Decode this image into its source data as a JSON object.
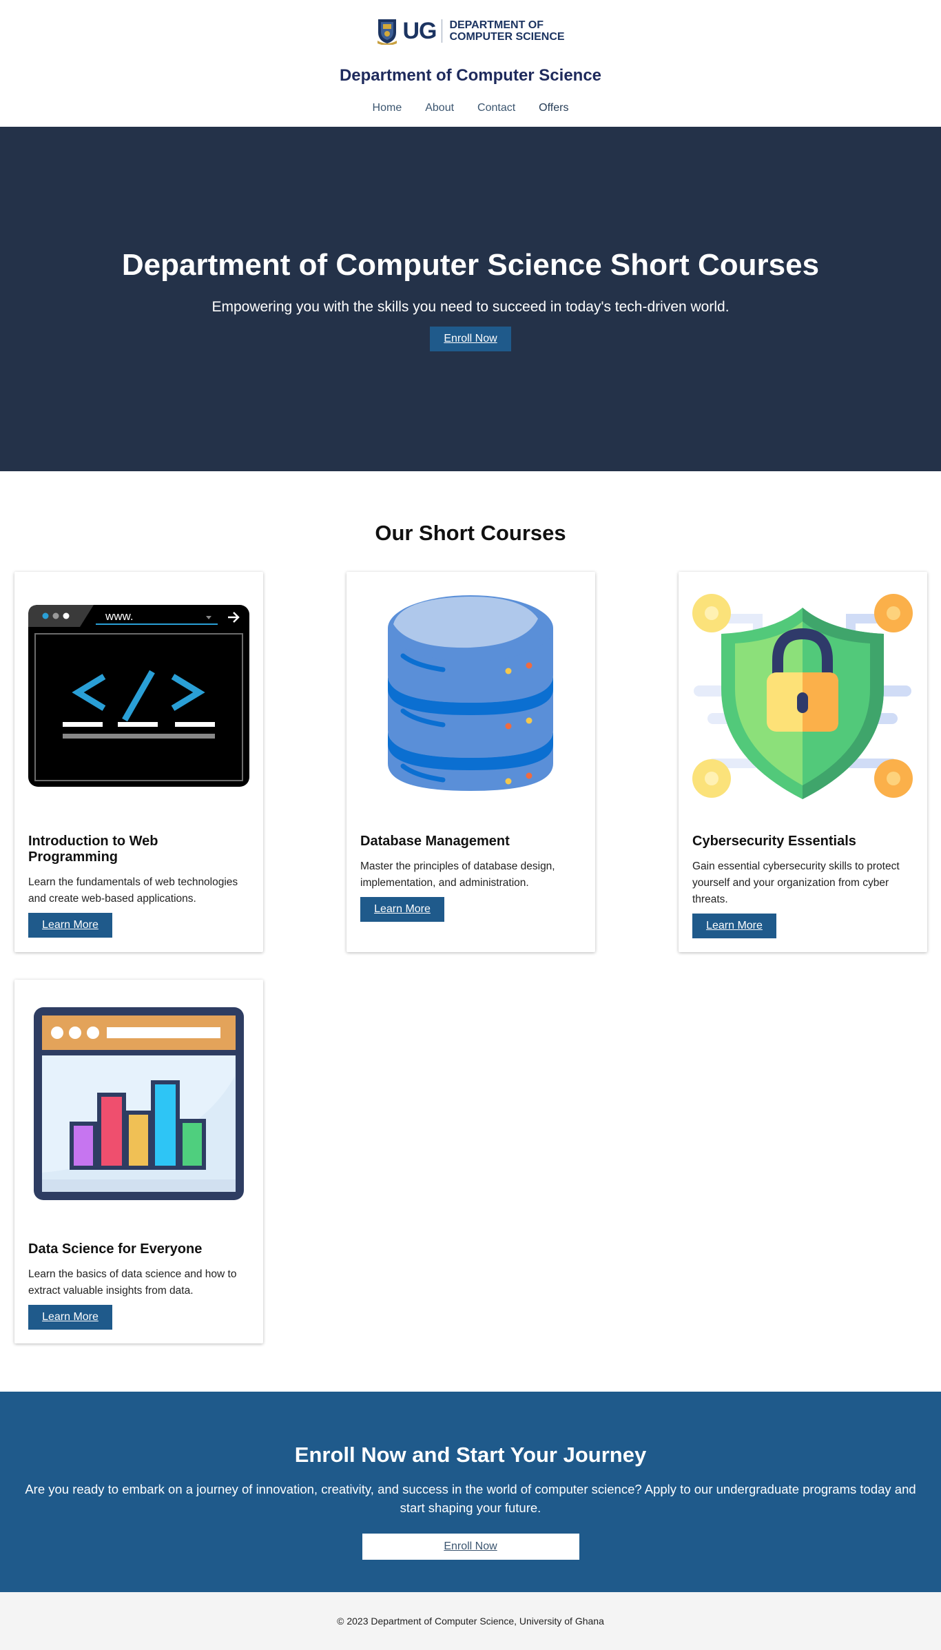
{
  "header": {
    "logo": {
      "mark": "UG",
      "line1": "DEPARTMENT OF",
      "line2": "COMPUTER SCIENCE",
      "icon": "ug-crest-icon"
    },
    "title": "Department of Computer Science",
    "nav": [
      "Home",
      "About",
      "Contact",
      "Offers"
    ]
  },
  "hero": {
    "heading": "Department of Computer Science Short Courses",
    "subheading": "Empowering you with the skills you need to succeed in today's tech-driven world.",
    "cta": "Enroll Now"
  },
  "courses": {
    "heading": "Our Short Courses",
    "items": [
      {
        "title": "Introduction to Web Programming",
        "description": "Learn the fundamentals of web technologies and create web-based applications.",
        "button": "Learn More",
        "image": "code-browser-icon",
        "url_text": "www."
      },
      {
        "title": "Database Management",
        "description": "Master the principles of database design, implementation, and administration.",
        "button": "Learn More",
        "image": "database-icon"
      },
      {
        "title": "Cybersecurity Essentials",
        "description": "Gain essential cybersecurity skills to protect yourself and your organization from cyber threats.",
        "button": "Learn More",
        "image": "shield-lock-icon"
      },
      {
        "title": "Data Science for Everyone",
        "description": "Learn the basics of data science and how to extract valuable insights from data.",
        "button": "Learn More",
        "image": "bar-chart-window-icon"
      }
    ]
  },
  "enroll": {
    "heading": "Enroll Now and Start Your Journey",
    "text": "Are you ready to embark on a journey of innovation, creativity, and success in the world of computer science? Apply to our undergraduate programs today and start shaping your future.",
    "cta": "Enroll Now"
  },
  "footer": {
    "text": "© 2023 Department of Computer Science, University of Ghana"
  },
  "colors": {
    "hero_bg": "#243249",
    "accent": "#1f5a8b",
    "title": "#1e2a5c",
    "footer_bg": "#f4f4f4"
  }
}
